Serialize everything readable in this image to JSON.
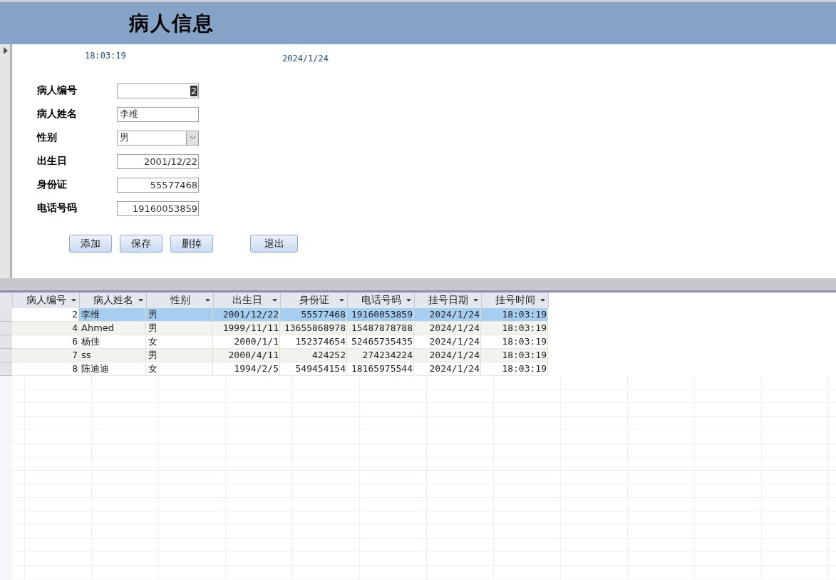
{
  "header": {
    "title": "病人信息"
  },
  "form": {
    "time": "18:03:19",
    "date": "2024/1/24",
    "fields": [
      {
        "label": "病人编号",
        "value": "2",
        "kind": "id"
      },
      {
        "label": "病人姓名",
        "value": "李维",
        "kind": "text"
      },
      {
        "label": "性别",
        "value": "男",
        "kind": "dropdown"
      },
      {
        "label": "出生日",
        "value": "2001/12/22",
        "kind": "number"
      },
      {
        "label": "身份证",
        "value": "55577468",
        "kind": "number"
      },
      {
        "label": "电话号码",
        "value": "19160053859",
        "kind": "number"
      }
    ],
    "buttons": [
      "添加",
      "保存",
      "删掉",
      "退出"
    ]
  },
  "table": {
    "columns": [
      {
        "label": "病人编号",
        "kind": "number"
      },
      {
        "label": "病人姓名",
        "kind": "text"
      },
      {
        "label": "性别",
        "kind": "text"
      },
      {
        "label": "出生日",
        "kind": "number"
      },
      {
        "label": "身份证",
        "kind": "number"
      },
      {
        "label": "电话号码",
        "kind": "number"
      },
      {
        "label": "挂号日期",
        "kind": "number"
      },
      {
        "label": "挂号时间",
        "kind": "number"
      }
    ],
    "rows": [
      {
        "selected": true,
        "cells": [
          "2",
          "李维",
          "男",
          "2001/12/22",
          "55577468",
          "19160053859",
          "2024/1/24",
          "18:03:19"
        ]
      },
      {
        "selected": false,
        "cells": [
          "4",
          "Ahmed",
          "男",
          "1999/11/11",
          "13655868978",
          "15487878788",
          "2024/1/24",
          "18:03:19"
        ]
      },
      {
        "selected": false,
        "cells": [
          "6",
          "杨佳",
          "女",
          "2000/1/1",
          "152374654",
          "52465735435",
          "2024/1/24",
          "18:03:19"
        ]
      },
      {
        "selected": false,
        "cells": [
          "7",
          "ss",
          "男",
          "2000/4/11",
          "424252",
          "274234224",
          "2024/1/24",
          "18:03:19"
        ]
      },
      {
        "selected": false,
        "cells": [
          "8",
          "陈迪迪",
          "女",
          "1994/2/5",
          "549454154",
          "18165975544",
          "2024/1/24",
          "18:03:19"
        ]
      }
    ]
  }
}
